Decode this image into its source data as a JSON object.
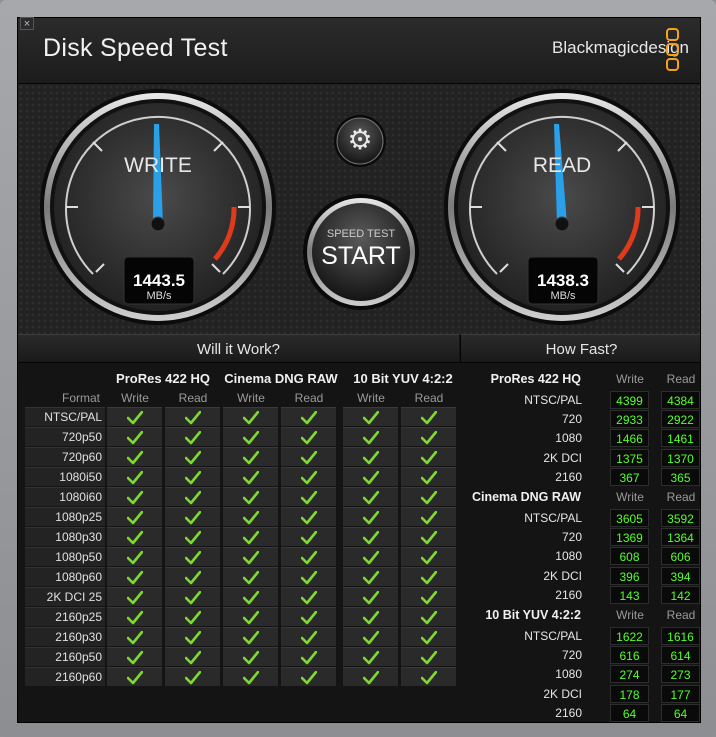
{
  "window": {
    "close_glyph": "×",
    "app_title": "Disk Speed Test",
    "brand": "Blackmagicdesign"
  },
  "gauges": {
    "write": {
      "label": "WRITE",
      "value": "1443.5",
      "unit": "MB/s"
    },
    "read": {
      "label": "READ",
      "value": "1438.3",
      "unit": "MB/s"
    }
  },
  "start_button": {
    "caption": "SPEED TEST",
    "label": "START"
  },
  "settings_icon": "gear-icon",
  "colors": {
    "accent_blue": "#2aa0e8",
    "value_green": "#55ff2a",
    "brand_orange": "#f5a21b",
    "danger_red": "#e03a1c"
  },
  "will_it_work": {
    "title": "Will it Work?",
    "format_header": "Format",
    "groups": [
      {
        "name": "ProRes 422 HQ",
        "write": "Write",
        "read": "Read"
      },
      {
        "name": "Cinema DNG RAW",
        "write": "Write",
        "read": "Read"
      },
      {
        "name": "10 Bit YUV 4:2:2",
        "write": "Write",
        "read": "Read"
      }
    ],
    "formats": [
      "NTSC/PAL",
      "720p50",
      "720p60",
      "1080i50",
      "1080i60",
      "1080p25",
      "1080p30",
      "1080p50",
      "1080p60",
      "2K DCI 25",
      "2160p25",
      "2160p30",
      "2160p50",
      "2160p60"
    ]
  },
  "how_fast": {
    "title": "How Fast?",
    "groups": [
      {
        "name": "ProRes 422 HQ",
        "write": "Write",
        "read": "Read",
        "rows": [
          {
            "label": "NTSC/PAL",
            "write": "4399",
            "read": "4384"
          },
          {
            "label": "720",
            "write": "2933",
            "read": "2922"
          },
          {
            "label": "1080",
            "write": "1466",
            "read": "1461"
          },
          {
            "label": "2K DCI",
            "write": "1375",
            "read": "1370"
          },
          {
            "label": "2160",
            "write": "367",
            "read": "365"
          }
        ]
      },
      {
        "name": "Cinema DNG RAW",
        "write": "Write",
        "read": "Read",
        "rows": [
          {
            "label": "NTSC/PAL",
            "write": "3605",
            "read": "3592"
          },
          {
            "label": "720",
            "write": "1369",
            "read": "1364"
          },
          {
            "label": "1080",
            "write": "608",
            "read": "606"
          },
          {
            "label": "2K DCI",
            "write": "396",
            "read": "394"
          },
          {
            "label": "2160",
            "write": "143",
            "read": "142"
          }
        ]
      },
      {
        "name": "10 Bit YUV 4:2:2",
        "write": "Write",
        "read": "Read",
        "rows": [
          {
            "label": "NTSC/PAL",
            "write": "1622",
            "read": "1616"
          },
          {
            "label": "720",
            "write": "616",
            "read": "614"
          },
          {
            "label": "1080",
            "write": "274",
            "read": "273"
          },
          {
            "label": "2K DCI",
            "write": "178",
            "read": "177"
          },
          {
            "label": "2160",
            "write": "64",
            "read": "64"
          }
        ]
      }
    ]
  }
}
